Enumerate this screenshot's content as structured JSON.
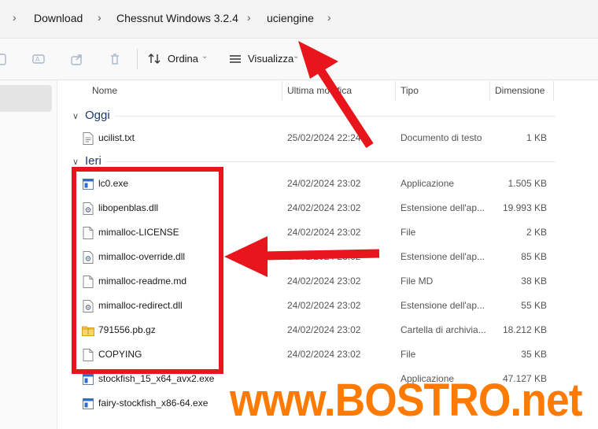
{
  "breadcrumb": {
    "items": [
      "Download",
      "Chessnut Windows 3.2.4",
      "uciengine"
    ]
  },
  "toolbar": {
    "sort_label": "Ordina",
    "view_label": "Visualizza",
    "more_label": "···"
  },
  "columns": {
    "name": "Nome",
    "modified": "Ultima modifica",
    "type": "Tipo",
    "size": "Dimensione"
  },
  "groups": [
    {
      "label": "Oggi",
      "files": [
        {
          "name": "ucilist.txt",
          "date": "25/02/2024 22:24",
          "type": "Documento di testo",
          "size": "1 KB",
          "icon": "text-file-icon"
        }
      ]
    },
    {
      "label": "Ieri",
      "files": [
        {
          "name": "lc0.exe",
          "date": "24/02/2024 23:02",
          "type": "Applicazione",
          "size": "1.505 KB",
          "icon": "exe-icon"
        },
        {
          "name": "libopenblas.dll",
          "date": "24/02/2024 23:02",
          "type": "Estensione dell'ap...",
          "size": "19.993 KB",
          "icon": "dll-icon"
        },
        {
          "name": "mimalloc-LICENSE",
          "date": "24/02/2024 23:02",
          "type": "File",
          "size": "2 KB",
          "icon": "file-icon"
        },
        {
          "name": "mimalloc-override.dll",
          "date": "24/02/2024 23:02",
          "type": "Estensione dell'ap...",
          "size": "85 KB",
          "icon": "dll-icon"
        },
        {
          "name": "mimalloc-readme.md",
          "date": "24/02/2024 23:02",
          "type": "File MD",
          "size": "38 KB",
          "icon": "file-icon"
        },
        {
          "name": "mimalloc-redirect.dll",
          "date": "24/02/2024 23:02",
          "type": "Estensione dell'ap...",
          "size": "55 KB",
          "icon": "dll-icon"
        },
        {
          "name": "791556.pb.gz",
          "date": "24/02/2024 23:02",
          "type": "Cartella di archivia...",
          "size": "18.212 KB",
          "icon": "zip-folder-icon"
        },
        {
          "name": "COPYING",
          "date": "24/02/2024 23:02",
          "type": "File",
          "size": "35 KB",
          "icon": "file-icon"
        },
        {
          "name": "stockfish_15_x64_avx2.exe",
          "date": "",
          "type": "Applicazione",
          "size": "47.127 KB",
          "icon": "exe-icon"
        },
        {
          "name": "fairy-stockfish_x86-64.exe",
          "date": "",
          "type": "",
          "size": "",
          "icon": "exe-icon"
        }
      ]
    }
  ],
  "watermark": "www.BOSTRO.net",
  "colors": {
    "annotation_red": "#e8151c",
    "watermark_orange": "#ff7a00",
    "group_blue": "#1e3a6a"
  }
}
